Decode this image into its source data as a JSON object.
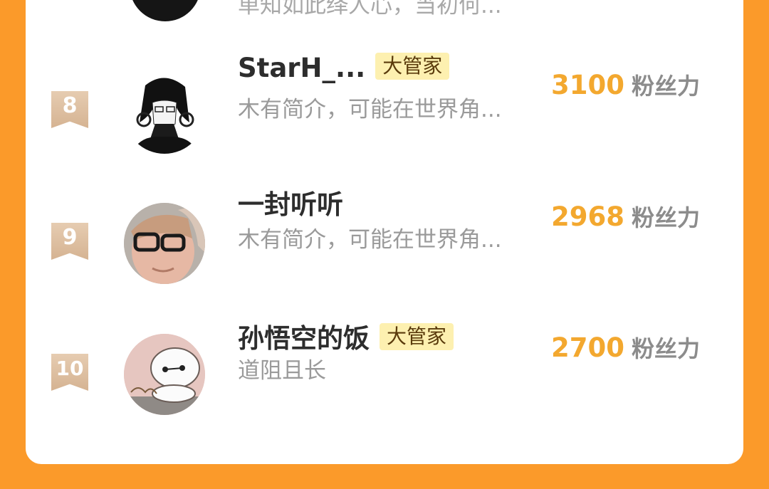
{
  "top_partial": {
    "bio": "单知如此绎人心，当初何..."
  },
  "rows": [
    {
      "rank": "8",
      "name": "StarH_...",
      "tag": "大管家",
      "bio": "木有简介，可能在世界角...",
      "score": "3100",
      "unit": "粉丝力"
    },
    {
      "rank": "9",
      "name": "一封听听",
      "tag": "",
      "bio": "木有简介，可能在世界角...",
      "score": "2968",
      "unit": "粉丝力"
    },
    {
      "rank": "10",
      "name": "孙悟空的饭",
      "tag": "大管家",
      "bio": "道阻且长",
      "score": "2700",
      "unit": "粉丝力"
    }
  ],
  "colors": {
    "page_background": "#fb9a2a",
    "score": "#f3a82f",
    "tag_background": "#fdf0b0",
    "rank_badge": "#d9b797"
  },
  "icons": {
    "rank_badge": "ribbon-bookmark-icon"
  }
}
